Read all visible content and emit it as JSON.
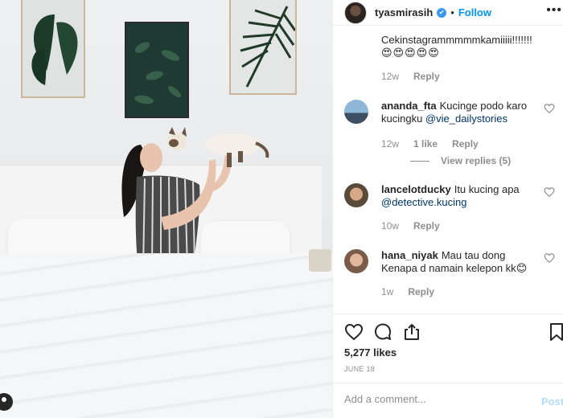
{
  "post": {
    "username": "tyasmirasih",
    "verified_glyph": "✔",
    "dot": "•",
    "follow_label": "Follow",
    "more_glyph": "•••",
    "likes": "5,277 likes",
    "date": "JUNE 18",
    "add_comment_placeholder": "Add a comment...",
    "post_label": "Post"
  },
  "comments": {
    "truncated_text": "Cekinstagrammmmmkamiiiii!!!!!!!",
    "truncated_emojis": "😍😍😍😍😍",
    "truncated_time": "12w",
    "truncated_reply": "Reply",
    "items": [
      {
        "username": "ananda_fta",
        "text": "Kucinge podo karo kucingku ",
        "mention": "@vie_dailystories",
        "text_after": "",
        "time": "12w",
        "likes": "1 like",
        "reply": "Reply",
        "view_replies": "View replies (5)"
      },
      {
        "username": "lancelotducky",
        "text": "Itu kucing apa ",
        "mention": "@detective.kucing",
        "text_after": "",
        "time": "10w",
        "likes": "",
        "reply": "Reply"
      },
      {
        "username": "hana_niyak",
        "text": "Mau tau dong Kenapa d namain kelepon kk",
        "mention": "",
        "text_after": "😊",
        "time": "1w",
        "likes": "",
        "reply": "Reply"
      }
    ]
  },
  "icons": {
    "heart": "heart-icon",
    "comment": "comment-icon",
    "share": "share-icon",
    "bookmark": "bookmark-icon"
  },
  "colors": {
    "accent": "#0095f6",
    "verified": "#3897f0",
    "muted": "#8e8e8e",
    "mention": "#00376b"
  }
}
